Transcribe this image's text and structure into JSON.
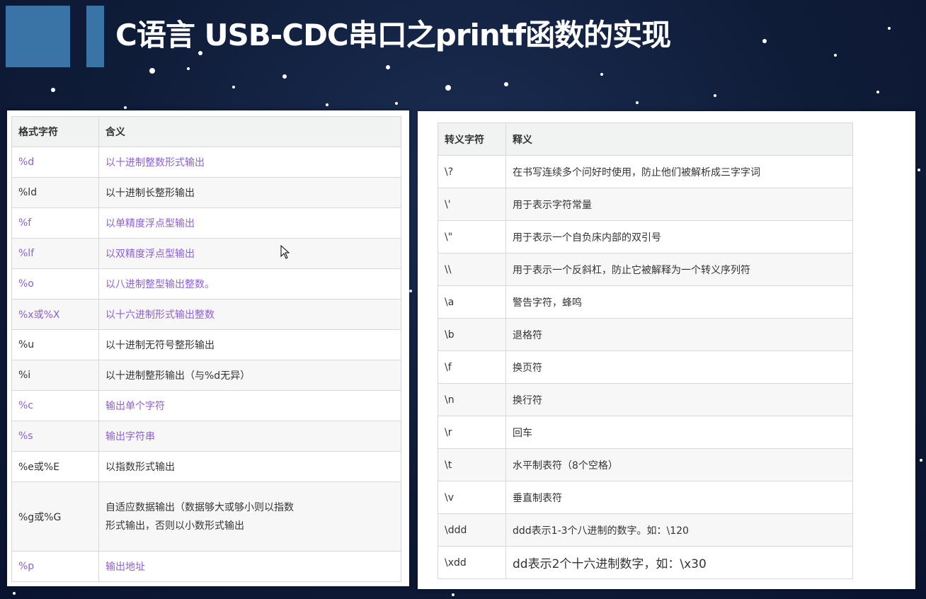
{
  "title": "C语言 USB-CDC串口之printf函数的实现",
  "format_table": {
    "headers": [
      "格式字符",
      "含义"
    ],
    "rows": [
      {
        "code": "%d",
        "meaning": "以十进制整数形式输出",
        "link": true
      },
      {
        "code": "%ld",
        "meaning": "以十进制长整形输出",
        "link": false
      },
      {
        "code": "%f",
        "meaning": "以单精度浮点型输出",
        "link": true
      },
      {
        "code": "%lf",
        "meaning": "以双精度浮点型输出",
        "link": true
      },
      {
        "code": "%o",
        "meaning": "以八进制整型输出整数。",
        "link": true
      },
      {
        "code": "%x或%X",
        "meaning": "以十六进制形式输出整数",
        "link": true
      },
      {
        "code": "%u",
        "meaning": "以十进制无符号整形输出",
        "link": false
      },
      {
        "code": "%i",
        "meaning": "以十进制整形输出（与%d无异）",
        "link": false
      },
      {
        "code": "%c",
        "meaning": "输出单个字符",
        "link": true
      },
      {
        "code": "%s",
        "meaning": "输出字符串",
        "link": true
      },
      {
        "code": "%e或%E",
        "meaning": "以指数形式输出",
        "link": false
      },
      {
        "code": "%g或%G",
        "meaning": "自适应数据输出（数据够大或够小则以指数形式输出，否则以小数形式输出",
        "link": false
      },
      {
        "code": "%p",
        "meaning": "输出地址",
        "link": true
      }
    ]
  },
  "escape_table": {
    "headers": [
      "转义字符",
      "释义"
    ],
    "rows": [
      {
        "code": "\\?",
        "meaning": "在书写连续多个问好时使用，防止他们被解析成三字字词"
      },
      {
        "code": "\\'",
        "meaning": "用于表示字符常量"
      },
      {
        "code": "\\\"",
        "meaning": "用于表示一个自负床内部的双引号"
      },
      {
        "code": "\\\\",
        "meaning": "用于表示一个反斜杠，防止它被解释为一个转义序列符"
      },
      {
        "code": "\\a",
        "meaning": "警告字符，蜂鸣"
      },
      {
        "code": "\\b",
        "meaning": "退格符"
      },
      {
        "code": "\\f",
        "meaning": "换页符"
      },
      {
        "code": "\\n",
        "meaning": "换行符"
      },
      {
        "code": "\\r",
        "meaning": "回车"
      },
      {
        "code": "\\t",
        "meaning": "水平制表符（8个空格）"
      },
      {
        "code": "\\v",
        "meaning": "垂直制表符"
      },
      {
        "code": "\\ddd",
        "meaning": "ddd表示1-3个八进制的数字。如：\\120"
      },
      {
        "code": "\\xdd",
        "meaning": "dd表示2个十六进制数字，如：\\x30"
      }
    ]
  },
  "colors": {
    "background": "#0f1c38",
    "accent": "#3a73a6",
    "link": "#8e5fd6",
    "header_bg": "#f1f3f3"
  },
  "icons": {
    "cursor": "mouse-pointer-icon"
  }
}
